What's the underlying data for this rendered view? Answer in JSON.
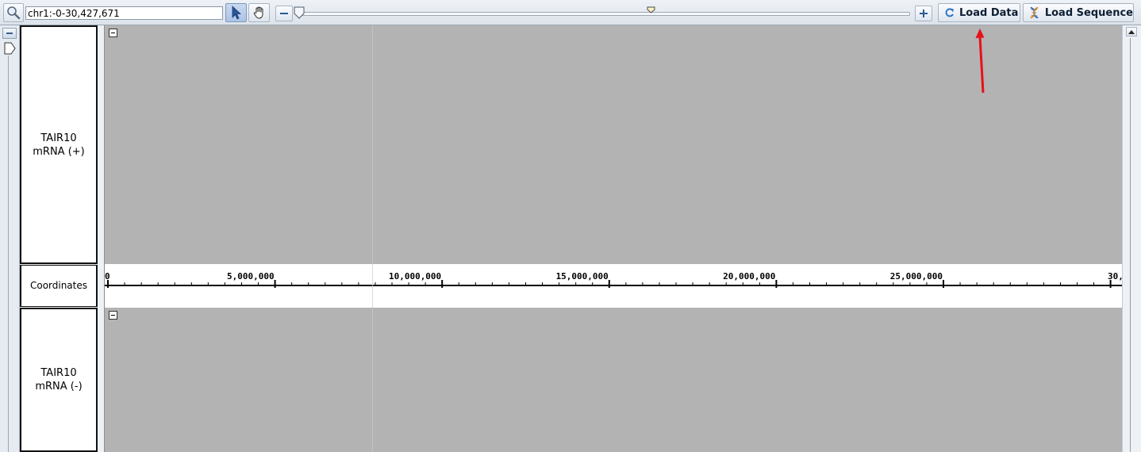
{
  "toolbar": {
    "locus_value": "chr1:-0-30,427,671",
    "load_data_label": "Load Data",
    "load_sequence_label": "Load Sequence"
  },
  "tracks": {
    "plus_label": "TAIR10\nmRNA (+)",
    "coordinates_label": "Coordinates",
    "minus_label": "TAIR10\nmRNA (-)"
  },
  "ruler": {
    "tick_labels": [
      "0",
      "5,000,000",
      "10,000,000",
      "15,000,000",
      "20,000,000",
      "25,000,000",
      "30,"
    ]
  },
  "colors": {
    "track_background": "#b3b3b3",
    "annotation_arrow": "#e8101a"
  },
  "icons": {
    "search": "magnifier-icon",
    "select": "cursor-arrow-icon",
    "pan": "hand-icon",
    "zoom_out": "minus-icon",
    "zoom_in": "plus-icon",
    "load_data": "refresh-icon",
    "load_sequence": "dna-icon"
  }
}
